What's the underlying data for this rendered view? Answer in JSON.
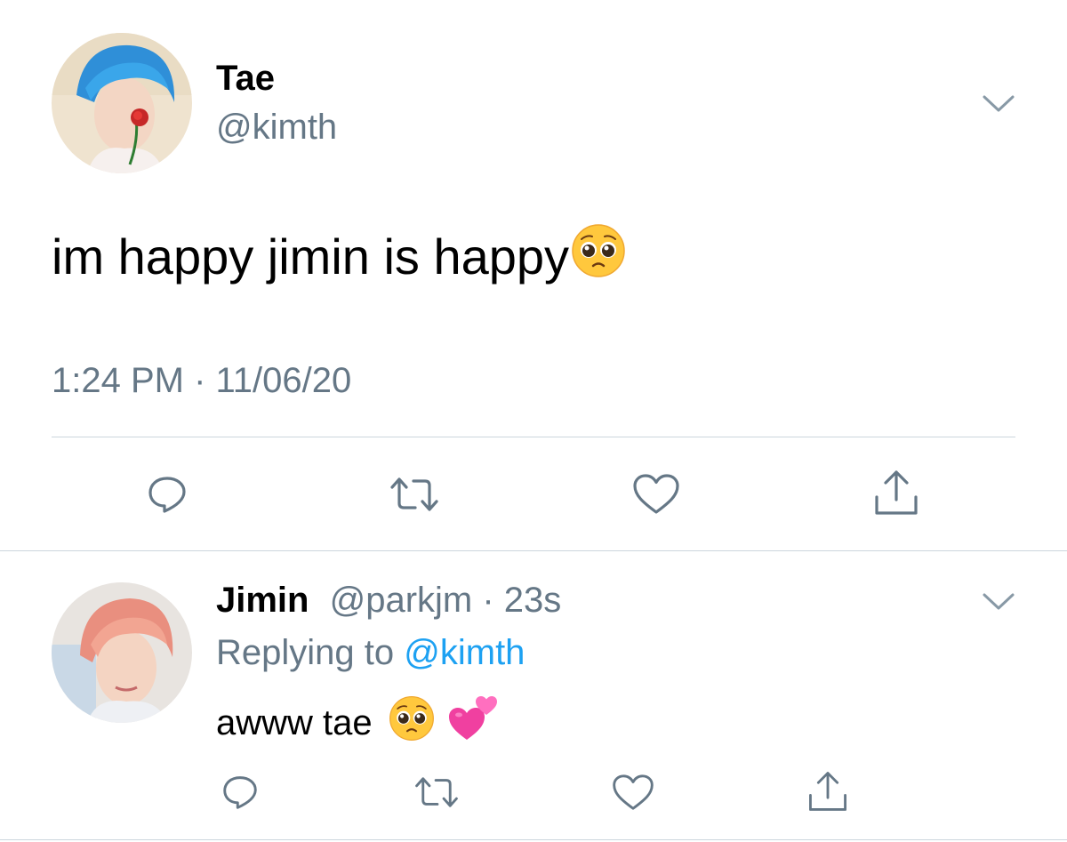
{
  "main_tweet": {
    "display_name": "Tae",
    "handle": "@kimth",
    "text": "im happy jimin is happy",
    "emoji": "pleading-face-emoji",
    "timestamp": "1:24 PM · 11/06/20"
  },
  "reply_tweet": {
    "display_name": "Jimin",
    "handle": "@parkjm",
    "time": "· 23s",
    "replying_prefix": "Replying to",
    "replying_handle": "@kimth",
    "text": "awww tae",
    "emojis": [
      "pleading-face-emoji",
      "two-hearts-emoji"
    ]
  },
  "actions": [
    "reply-icon",
    "retweet-icon",
    "like-icon",
    "share-icon"
  ],
  "colors": {
    "text": "#000000",
    "secondary": "#657786",
    "link": "#1da1f2",
    "divider": "#ccd6dd",
    "emoji_face": "#ffc83d",
    "heart_pink": "#f040a0"
  }
}
